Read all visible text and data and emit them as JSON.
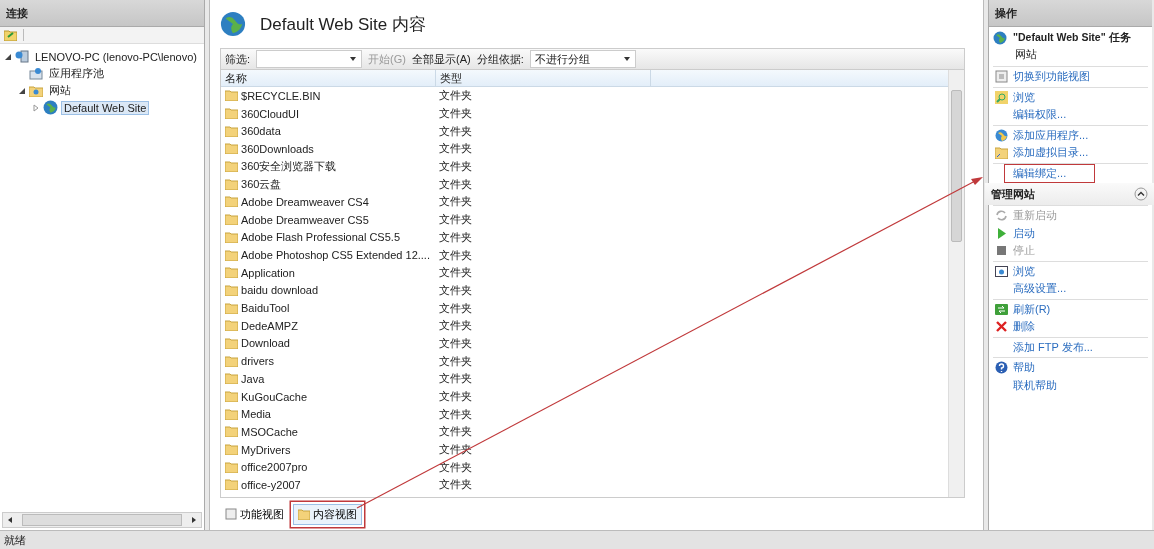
{
  "connections": {
    "title": "连接",
    "tree": [
      {
        "label": "LENOVO-PC (lenovo-PC\\lenovo)",
        "kind": "server",
        "expanded": true,
        "selected": false,
        "children": [
          {
            "label": "应用程序池",
            "kind": "pool",
            "selected": false
          },
          {
            "label": "网站",
            "kind": "sites",
            "expanded": true,
            "selected": false,
            "children": [
              {
                "label": "Default Web Site",
                "kind": "site",
                "expanded": false,
                "selected": true
              }
            ]
          }
        ]
      }
    ]
  },
  "content": {
    "title": "Default Web Site 内容",
    "toolbar": {
      "filter_label": "筛选:",
      "start": {
        "label": "开始(G)",
        "disabled": true
      },
      "show_all": {
        "label": "全部显示(A)",
        "disabled": false
      },
      "group_label": "分组依据:",
      "group_value": "不进行分组"
    },
    "columns": [
      "名称",
      "类型"
    ],
    "rows": [
      {
        "name": "$RECYCLE.BIN",
        "type": "文件夹"
      },
      {
        "name": "360CloudUI",
        "type": "文件夹"
      },
      {
        "name": "360data",
        "type": "文件夹"
      },
      {
        "name": "360Downloads",
        "type": "文件夹"
      },
      {
        "name": "360安全浏览器下载",
        "type": "文件夹"
      },
      {
        "name": "360云盘",
        "type": "文件夹"
      },
      {
        "name": "Adobe Dreamweaver CS4",
        "type": "文件夹"
      },
      {
        "name": "Adobe Dreamweaver CS5",
        "type": "文件夹"
      },
      {
        "name": "Adobe Flash Professional CS5.5",
        "type": "文件夹"
      },
      {
        "name": "Adobe Photoshop CS5 Extended 12....",
        "type": "文件夹"
      },
      {
        "name": "Application",
        "type": "文件夹"
      },
      {
        "name": "baidu download",
        "type": "文件夹"
      },
      {
        "name": "BaiduTool",
        "type": "文件夹"
      },
      {
        "name": "DedeAMPZ",
        "type": "文件夹"
      },
      {
        "name": "Download",
        "type": "文件夹"
      },
      {
        "name": "drivers",
        "type": "文件夹"
      },
      {
        "name": "Java",
        "type": "文件夹"
      },
      {
        "name": "KuGouCache",
        "type": "文件夹"
      },
      {
        "name": "Media",
        "type": "文件夹"
      },
      {
        "name": "MSOCache",
        "type": "文件夹"
      },
      {
        "name": "MyDrivers",
        "type": "文件夹"
      },
      {
        "name": "office2007pro",
        "type": "文件夹"
      },
      {
        "name": "office-y2007",
        "type": "文件夹"
      }
    ],
    "view_tabs": [
      {
        "label": "功能视图",
        "selected": false,
        "highlighted": false
      },
      {
        "label": "内容视图",
        "selected": true,
        "highlighted": true
      }
    ]
  },
  "actions": {
    "title": "操作",
    "site_title": "\"Default Web Site\" 任务",
    "site_subtitle": "网站",
    "sections": [
      {
        "items": [
          {
            "label": "切换到功能视图",
            "kind": "view",
            "disabled": false,
            "highlighted": false
          }
        ]
      },
      {
        "items": [
          {
            "label": "浏览",
            "kind": "browse",
            "disabled": false,
            "highlighted": false
          },
          {
            "label": "编辑权限...",
            "kind": "none",
            "disabled": false,
            "highlighted": false
          }
        ]
      },
      {
        "items": [
          {
            "label": "添加应用程序...",
            "kind": "add-app",
            "disabled": false,
            "highlighted": false
          },
          {
            "label": "添加虚拟目录...",
            "kind": "add-dir",
            "disabled": false,
            "highlighted": false
          }
        ]
      },
      {
        "items": [
          {
            "label": "编辑绑定...",
            "kind": "none",
            "disabled": false,
            "highlighted": true
          }
        ]
      },
      {
        "header": "管理网站",
        "expanded": true,
        "items": [
          {
            "label": "重新启动",
            "kind": "restart",
            "disabled": true,
            "highlighted": false
          },
          {
            "label": "启动",
            "kind": "start",
            "disabled": false,
            "highlighted": false
          },
          {
            "label": "停止",
            "kind": "stop",
            "disabled": true,
            "highlighted": false
          }
        ]
      },
      {
        "items": [
          {
            "label": "浏览",
            "kind": "browse-site",
            "disabled": false,
            "highlighted": false
          },
          {
            "label": "高级设置...",
            "kind": "none",
            "disabled": false,
            "highlighted": false
          }
        ]
      },
      {
        "items": [
          {
            "label": "刷新(R)",
            "kind": "refresh",
            "disabled": false,
            "highlighted": false
          },
          {
            "label": "删除",
            "kind": "delete",
            "disabled": false,
            "highlighted": false
          }
        ]
      },
      {
        "items": [
          {
            "label": "添加 FTP 发布...",
            "kind": "none",
            "disabled": false,
            "highlighted": false
          }
        ]
      },
      {
        "items": [
          {
            "label": "帮助",
            "kind": "help",
            "disabled": false,
            "highlighted": false
          },
          {
            "label": "联机帮助",
            "kind": "none",
            "disabled": false,
            "highlighted": false
          }
        ]
      }
    ]
  },
  "status_bar": "就绪"
}
